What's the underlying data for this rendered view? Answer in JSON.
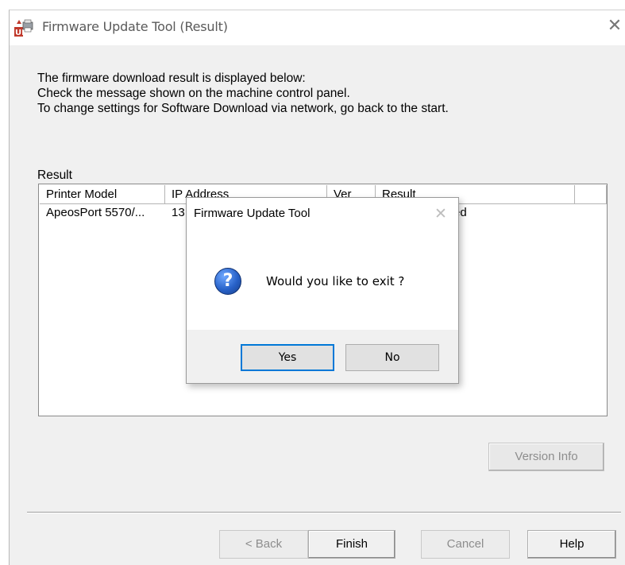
{
  "window": {
    "title": "Firmware Update Tool (Result)",
    "close_glyph": "✕"
  },
  "instructions": [
    "The firmware download result is displayed below:",
    "Check the message shown on the machine control panel.",
    "To change settings for Software Download via network, go back to the start."
  ],
  "result_label": "Result",
  "table": {
    "columns": [
      "Printer Model",
      "IP Address",
      "Ver",
      "Result",
      ""
    ],
    "rows": [
      {
        "model": "ApeosPort 5570/...",
        "ip": "13",
        "ver": "",
        "result": "rage Completed"
      }
    ]
  },
  "buttons": {
    "version_info": "Version Info",
    "back": "< Back",
    "finish": "Finish",
    "cancel": "Cancel",
    "help": "Help"
  },
  "dialog": {
    "title": "Firmware Update Tool",
    "close_glyph": "✕",
    "icon": "question-icon",
    "icon_glyph": "?",
    "message": "Would you like to exit ?",
    "yes": "Yes",
    "no": "No"
  },
  "colors": {
    "accent": "#0078d7",
    "window_bg": "#f0f0f0",
    "icon_blue": "#2862c9"
  }
}
